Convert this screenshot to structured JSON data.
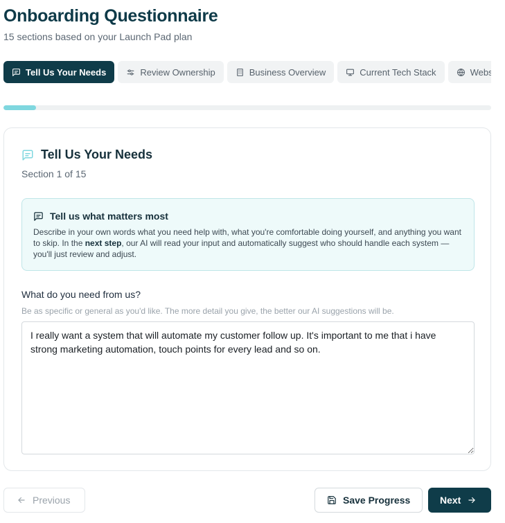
{
  "header": {
    "title": "Onboarding Questionnaire",
    "subtitle": "15 sections based on your Launch Pad plan"
  },
  "tabs": [
    {
      "label": "Tell Us Your Needs",
      "icon": "message-square-icon",
      "active": true
    },
    {
      "label": "Review Ownership",
      "icon": "sliders-icon",
      "active": false
    },
    {
      "label": "Business Overview",
      "icon": "building-icon",
      "active": false
    },
    {
      "label": "Current Tech Stack",
      "icon": "monitor-icon",
      "active": false
    },
    {
      "label": "Website",
      "icon": "globe-icon",
      "active": false
    }
  ],
  "progress": {
    "fraction": 0.0667
  },
  "section": {
    "title": "Tell Us Your Needs",
    "counter": "Section 1 of 15",
    "icon": "message-square-icon"
  },
  "callout": {
    "title": "Tell us what matters most",
    "body_before": "Describe in your own words what you need help with, what you're comfortable doing yourself, and anything you want to skip. In the ",
    "body_bold": "next step",
    "body_after": ", our AI will read your input and automatically suggest who should handle each system — you'll just review and adjust."
  },
  "field": {
    "label": "What do you need from us?",
    "hint": "Be as specific or general as you'd like. The more detail you give, the better our AI suggestions will be.",
    "value": "I really want a system that will automate my customer follow up. It's important to me that i have strong marketing automation, touch points for every lead and so on."
  },
  "footer": {
    "previous_label": "Previous",
    "save_label": "Save Progress",
    "next_label": "Next"
  },
  "colors": {
    "brand": "#0f3c49",
    "progress": "#7fd7df",
    "callout_bg": "#eefafa",
    "callout_border": "#bfe6e8"
  }
}
